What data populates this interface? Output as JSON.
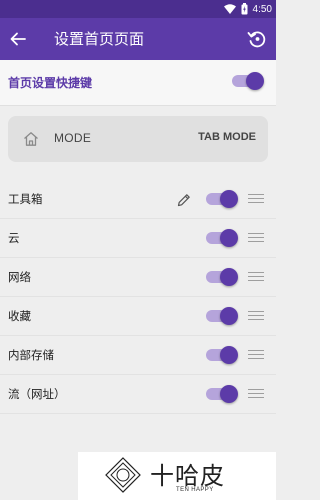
{
  "status_bar": {
    "time": "4:50"
  },
  "app_bar": {
    "title": "设置首页页面"
  },
  "master": {
    "label": "首页设置快捷键",
    "enabled": true
  },
  "mode_card": {
    "label": "MODE",
    "value": "TAB MODE"
  },
  "items": [
    {
      "label": "工具箱",
      "enabled": true,
      "editable": true
    },
    {
      "label": "云",
      "enabled": true,
      "editable": false
    },
    {
      "label": "网络",
      "enabled": true,
      "editable": false
    },
    {
      "label": "收藏",
      "enabled": true,
      "editable": false
    },
    {
      "label": "内部存储",
      "enabled": true,
      "editable": false
    },
    {
      "label": "流（网址）",
      "enabled": true,
      "editable": false
    }
  ],
  "watermark": {
    "title": "十哈皮",
    "subtitle": "TEN HAPPY"
  },
  "colors": {
    "primary": "#5c3ba8",
    "status_bar": "#4b2e8f",
    "toggle_track": "#b5a4db",
    "background": "#eeeeee"
  }
}
